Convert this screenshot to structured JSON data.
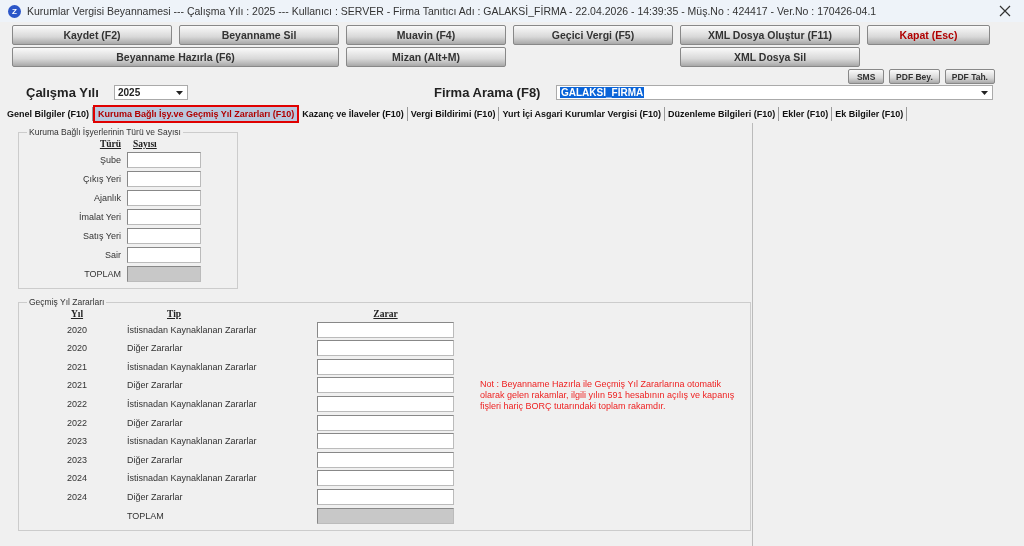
{
  "window": {
    "logo_letter": "Z",
    "title": "Kurumlar Vergisi Beyannamesi  ---  Çalışma Yılı : 2025  ---  Kullanıcı : SERVER - Firma Tanıtıcı Adı : GALAKSİ_FİRMA - 22.04.2026 - 14:39:35 - Müş.No : 424417 - Ver.No : 170426-04.1"
  },
  "toolbar_row_1": [
    {
      "label": "Kaydet (F2)",
      "kind": "action"
    },
    {
      "label": "Beyanname Sil",
      "kind": "action"
    },
    {
      "label": "Muavin (F4)",
      "kind": "action"
    },
    {
      "label": "Geçici Vergi (F5)",
      "kind": "action"
    },
    {
      "label": "XML Dosya Oluştur (F11)",
      "kind": "action"
    },
    {
      "label": "Kapat (Esc)",
      "kind": "close"
    }
  ],
  "toolbar_row_2": [
    "Beyanname Hazırla (F6)",
    "Mizan (Alt+M)",
    "XML Dosya Sil"
  ],
  "small_buttons": [
    "SMS",
    "PDF Bey.",
    "PDF Tah."
  ],
  "year_filter": {
    "label": "Çalışma Yılı",
    "value": "2025"
  },
  "company_search": {
    "label": "Firma Arama (F8)",
    "value": "GALAKSİ_FİRMA",
    "text_selected": true
  },
  "tabs": [
    {
      "label": "Genel Bilgiler (F10)",
      "selected": false
    },
    {
      "label": "Kuruma Bağlı İşy.ve Geçmiş Yıl Zararları (F10)",
      "selected": true
    },
    {
      "label": "Kazanç ve İlaveler (F10)",
      "selected": false
    },
    {
      "label": "Vergi Bildirimi (F10)",
      "selected": false
    },
    {
      "label": "Yurt İçi Asgari Kurumlar Vergisi (F10)",
      "selected": false
    },
    {
      "label": "Düzenleme Bilgileri (F10)",
      "selected": false
    },
    {
      "label": "Ekler (F10)",
      "selected": false
    },
    {
      "label": "Ek Bilgiler (F10)",
      "selected": false
    }
  ],
  "branches": {
    "title": "Kuruma Bağlı İşyerlerinin Türü ve Sayısı",
    "columns": [
      "Türü",
      "Sayısı"
    ],
    "rows": [
      "Şube",
      "Çıkış Yeri",
      "Ajanlık",
      "İmalat Yeri",
      "Satış Yeri",
      "Sair"
    ],
    "total_label": "TOPLAM"
  },
  "past_losses": {
    "title": "Geçmiş Yıl Zararları",
    "columns": [
      "Yıl",
      "Tip",
      "Zarar"
    ],
    "rows": [
      {
        "year": "2020",
        "type": "İstisnadan Kaynaklanan Zararlar"
      },
      {
        "year": "2020",
        "type": "Diğer Zararlar"
      },
      {
        "year": "2021",
        "type": "İstisnadan Kaynaklanan Zararlar"
      },
      {
        "year": "2021",
        "type": "Diğer Zararlar"
      },
      {
        "year": "2022",
        "type": "İstisnadan Kaynaklanan Zararlar"
      },
      {
        "year": "2022",
        "type": "Diğer Zararlar"
      },
      {
        "year": "2023",
        "type": "İstisnadan Kaynaklanan Zararlar"
      },
      {
        "year": "2023",
        "type": "Diğer Zararlar"
      },
      {
        "year": "2024",
        "type": "İstisnadan Kaynaklanan Zararlar"
      },
      {
        "year": "2024",
        "type": "Diğer Zararlar"
      }
    ],
    "total_label": "TOPLAM",
    "note": "Not : Beyanname Hazırla ile Geçmiş Yıl Zararlarına otomatik olarak gelen rakamlar, ilgili yılın 591 hesabının açılış ve kapanış fişleri hariç BORÇ tutarındaki toplam rakamdır."
  }
}
